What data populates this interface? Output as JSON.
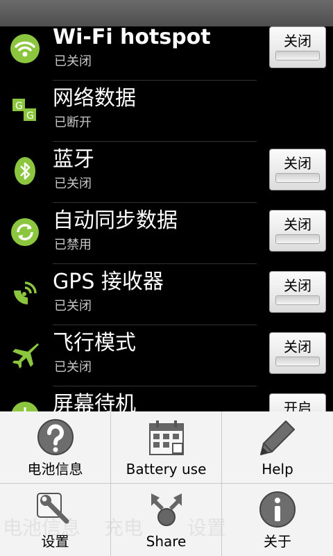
{
  "settings": [
    {
      "title": "Wi-Fi hotspot",
      "status": "已关闭",
      "icon": "wifi-icon",
      "toggle": "关闭",
      "on": false
    },
    {
      "title": "网络数据",
      "status": "已断开",
      "icon": "network-data-icon",
      "toggle": null
    },
    {
      "title": "蓝牙",
      "status": "已关闭",
      "icon": "bluetooth-icon",
      "toggle": "关闭",
      "on": false
    },
    {
      "title": "自动同步数据",
      "status": "已禁用",
      "icon": "sync-icon",
      "toggle": "关闭",
      "on": false
    },
    {
      "title": "GPS 接收器",
      "status": "已关闭",
      "icon": "gps-icon",
      "toggle": "关闭",
      "on": false
    },
    {
      "title": "飞行模式",
      "status": "已关闭",
      "icon": "airplane-icon",
      "toggle": "关闭",
      "on": false
    },
    {
      "title": "屏幕待机",
      "status": "",
      "icon": "screen-timeout-icon",
      "toggle": "开启",
      "on": true
    }
  ],
  "menu": {
    "items": [
      {
        "label": "电池信息",
        "icon": "help-question-icon"
      },
      {
        "label": "Battery use",
        "icon": "calendar-grid-icon"
      },
      {
        "label": "Help",
        "icon": "pencil-icon"
      },
      {
        "label": "设置",
        "icon": "wrench-settings-icon"
      },
      {
        "label": "Share",
        "icon": "share-icon"
      },
      {
        "label": "关于",
        "icon": "info-icon"
      }
    ],
    "background_text": [
      "电池信息",
      "充电",
      "设置"
    ]
  },
  "colors": {
    "accent_green": "#8cc63f",
    "panel_bg": "#000000",
    "menu_bg": "#f3f3f3"
  }
}
